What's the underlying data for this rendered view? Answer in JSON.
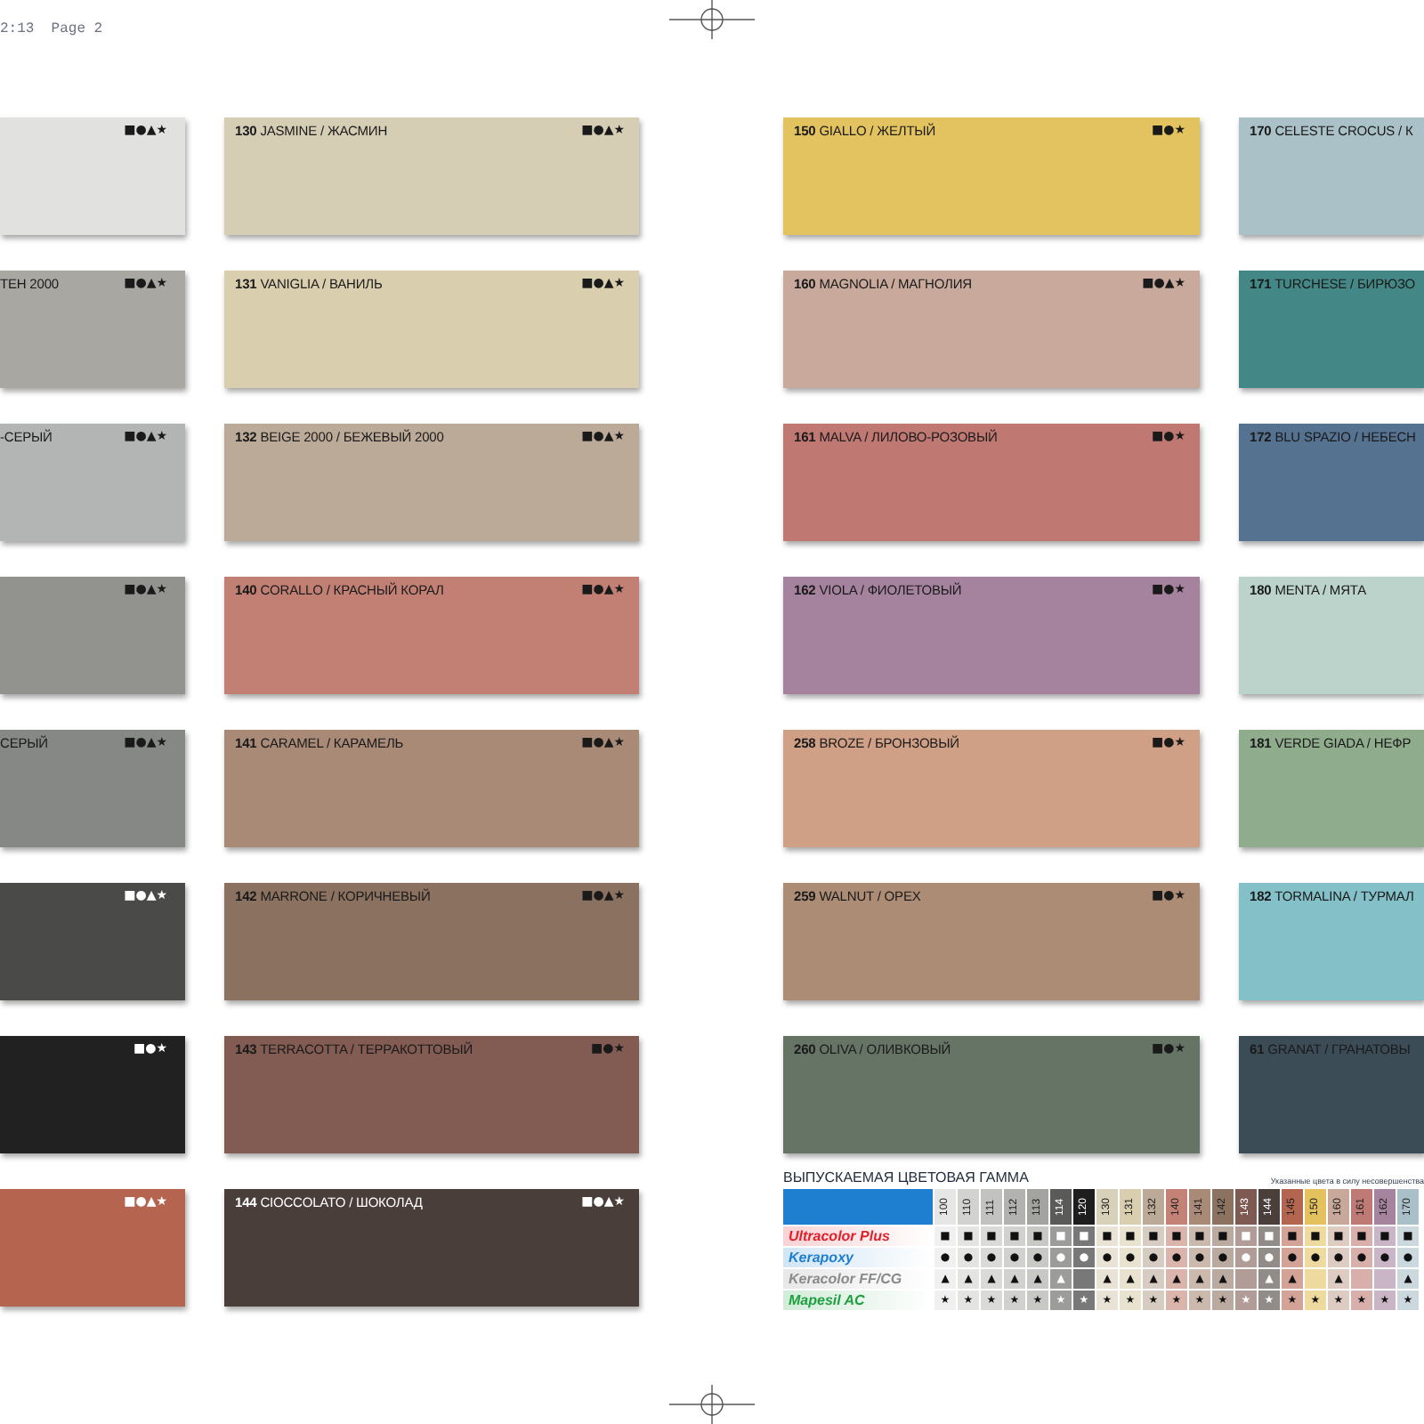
{
  "print_header": "2:13  Page 2",
  "swatch_columns": [
    {
      "swatches": [
        {
          "color": "#e1e1e0",
          "light_text": false,
          "symbols": "■●▲★"
        },
        {
          "label": "ТЕН 2000",
          "color": "#a8a7a2",
          "light_text": false,
          "symbols": "■●▲★"
        },
        {
          "label": "-СЕРЫЙ",
          "color": "#b3b5b4",
          "light_text": false,
          "symbols": "■●▲★"
        },
        {
          "color": "#92938e",
          "light_text": false,
          "symbols": "■●▲★"
        },
        {
          "label": "СЕРЫЙ",
          "color": "#858884",
          "light_text": false,
          "symbols": "■●▲★"
        },
        {
          "color": "#4a4a48",
          "light_text": true,
          "symbols": "■●▲★"
        },
        {
          "color": "#222121",
          "light_text": true,
          "symbols": "■●★"
        },
        {
          "color": "#b5644f",
          "light_text": true,
          "symbols": "■●▲★"
        }
      ]
    },
    {
      "swatches": [
        {
          "label": "**130** JASMINE / ЖАСМИН",
          "color": "#d6cdb5",
          "light_text": false,
          "symbols": "■●▲★"
        },
        {
          "label": "**131** VANIGLIA / ВАНИЛЬ",
          "color": "#d9ceae",
          "light_text": false,
          "symbols": "■●▲★"
        },
        {
          "label": "**132** BEIGE 2000 / БЕЖЕВЫЙ 2000",
          "color": "#bcaa98",
          "light_text": false,
          "symbols": "■●▲★"
        },
        {
          "label": "**140** CORALLO / КРАСНЫЙ КОРАЛ",
          "color": "#c28075",
          "light_text": false,
          "symbols": "■●▲★"
        },
        {
          "label": "**141** CARAMEL / КАРАМЕЛЬ",
          "color": "#a98a76",
          "light_text": false,
          "symbols": "■●▲★"
        },
        {
          "label": "**142** MARRONE / КОРИЧНЕВЫЙ",
          "color": "#8b7160",
          "light_text": false,
          "symbols": "■●▲★"
        },
        {
          "label": "**143** TERRACOTTA / ТЕРРАКОТТОВЫЙ",
          "color": "#825b53",
          "light_text": false,
          "symbols": "■●★"
        },
        {
          "label": "**144** CIOCCOLATO / ШОКОЛАД",
          "color": "#4a3e3b",
          "light_text": true,
          "symbols": "■●▲★"
        }
      ]
    },
    {
      "swatches": [
        {
          "label": "**150** GIALLO / ЖЕЛТЫЙ",
          "color": "#e3c35f",
          "light_text": false,
          "symbols": "■●★"
        },
        {
          "label": "**160** MAGNOLIA / МАГНОЛИЯ",
          "color": "#c9a99c",
          "light_text": false,
          "symbols": "■●▲★"
        },
        {
          "label": "**161** MALVA / ЛИЛОВО-РОЗОВЫЙ",
          "color": "#c07872",
          "light_text": false,
          "symbols": "■●★"
        },
        {
          "label": "**162** VIOLA / ФИОЛЕТОВЫЙ",
          "color": "#a5839f",
          "light_text": false,
          "symbols": "■●★"
        },
        {
          "label": "**258** BROZE / БРОНЗОВЫЙ",
          "color": "#cfa085",
          "light_text": false,
          "symbols": "■●★"
        },
        {
          "label": "**259** WALNUT / ОРЕХ",
          "color": "#ad8c76",
          "light_text": false,
          "symbols": "■●★"
        },
        {
          "label": "**260** OLIVA / ОЛИВКОВЫЙ",
          "color": "#667465",
          "light_text": false,
          "symbols": "■●★"
        }
      ]
    },
    {
      "swatches": [
        {
          "label": "**170** CELESTE CROCUS / К",
          "color": "#abc1c8",
          "light_text": false
        },
        {
          "label": "**171** TURCHESE / БИРЮЗО",
          "color": "#438886",
          "light_text": false
        },
        {
          "label": "**172** BLU SPAZIO / НЕБЕСН",
          "color": "#557290",
          "light_text": false
        },
        {
          "label": "**180** MENTA / МЯТА",
          "color": "#bcd3cb",
          "light_text": false
        },
        {
          "label": "**181** VERDE GIADA / НЕФР",
          "color": "#8fad8d",
          "light_text": false
        },
        {
          "label": "**182** TORMALINA / ТУРМАЛ",
          "color": "#84c0c8",
          "light_text": false
        },
        {
          "label": "**61** GRANAT / ГРАНАТОВЫ",
          "color": "#3b4c57",
          "light_text": false
        }
      ]
    }
  ],
  "range_table": {
    "title": "ВЫПУСКАЕМАЯ ЦВЕТОВАЯ ГАММА",
    "note": "Указанные цвета в силу несовершенства",
    "columns": [
      {
        "code": "100",
        "color": "#e6e6e6",
        "light_text": false
      },
      {
        "code": "110",
        "color": "#d2d2d0",
        "light_text": false
      },
      {
        "code": "111",
        "color": "#c2c2c0",
        "light_text": false
      },
      {
        "code": "112",
        "color": "#b2b2b0",
        "light_text": false
      },
      {
        "code": "113",
        "color": "#a3a39f",
        "light_text": false
      },
      {
        "code": "114",
        "color": "#5a5a58",
        "light_text": true
      },
      {
        "code": "120",
        "color": "#1e1e1e",
        "light_text": true
      },
      {
        "code": "130",
        "color": "#d8d0b8",
        "light_text": false
      },
      {
        "code": "131",
        "color": "#d9cfae",
        "light_text": false
      },
      {
        "code": "132",
        "color": "#bcaa98",
        "light_text": false
      },
      {
        "code": "140",
        "color": "#c38275",
        "light_text": false
      },
      {
        "code": "141",
        "color": "#a98a76",
        "light_text": false
      },
      {
        "code": "142",
        "color": "#8c7260",
        "light_text": false
      },
      {
        "code": "143",
        "color": "#7f5a52",
        "light_text": true
      },
      {
        "code": "144",
        "color": "#4a3f3b",
        "light_text": true
      },
      {
        "code": "145",
        "color": "#b46550",
        "light_text": false
      },
      {
        "code": "150",
        "color": "#e3c25e",
        "light_text": false
      },
      {
        "code": "160",
        "color": "#c8a89a",
        "light_text": false
      },
      {
        "code": "161",
        "color": "#c07a75",
        "light_text": false
      },
      {
        "code": "162",
        "color": "#a684a0",
        "light_text": false
      },
      {
        "code": "170",
        "color": "#a9c0c8",
        "light_text": false
      }
    ],
    "rows": [
      {
        "product": "Ultracolor Plus",
        "color": "#e0202a",
        "symbol": "■",
        "marks": [
          true,
          true,
          true,
          true,
          true,
          true,
          true,
          true,
          true,
          true,
          true,
          true,
          true,
          true,
          true,
          true,
          true,
          true,
          true,
          true,
          true
        ]
      },
      {
        "product": "Kerapoxy",
        "color": "#1e7fd0",
        "symbol": "●",
        "marks": [
          true,
          true,
          true,
          true,
          true,
          true,
          true,
          true,
          true,
          true,
          true,
          true,
          true,
          true,
          true,
          true,
          true,
          true,
          true,
          true,
          true
        ]
      },
      {
        "product": "Keracolor FF/CG",
        "color": "#8a8a8a",
        "symbol": "▲",
        "marks": [
          true,
          true,
          true,
          true,
          true,
          true,
          false,
          true,
          true,
          true,
          true,
          true,
          true,
          false,
          true,
          true,
          false,
          true,
          false,
          false,
          true
        ]
      },
      {
        "product": "Mapesil AC",
        "color": "#1ea040",
        "symbol": "★",
        "marks": [
          true,
          true,
          true,
          true,
          true,
          true,
          true,
          true,
          true,
          true,
          true,
          true,
          true,
          true,
          true,
          true,
          true,
          true,
          true,
          true,
          true
        ]
      }
    ]
  }
}
